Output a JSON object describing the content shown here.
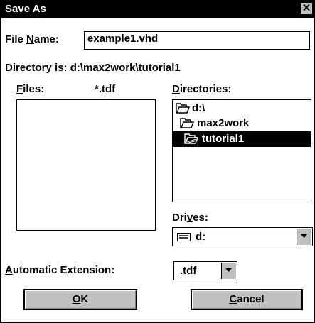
{
  "window": {
    "title": "Save As",
    "close_glyph": "✕"
  },
  "file_name": {
    "label_prefix": "File ",
    "label_key": "N",
    "label_suffix": "ame:",
    "value": "example1.vhd"
  },
  "directory": {
    "label": "Directory is:",
    "path": "d:\\max2work\\tutorial1"
  },
  "files": {
    "label_key": "F",
    "label_suffix": "iles:",
    "filter": "*.tdf",
    "items": []
  },
  "directories": {
    "label_key": "D",
    "label_suffix": "irectories:",
    "items": [
      {
        "label": "d:\\",
        "icon": "open-folder-icon",
        "selected": false
      },
      {
        "label": "max2work",
        "icon": "open-folder-icon",
        "selected": false
      },
      {
        "label": "tutorial1",
        "icon": "open-folder-icon",
        "selected": true
      }
    ]
  },
  "drives": {
    "label_prefix": "Dri",
    "label_key": "v",
    "label_suffix": "es:",
    "value": "d:",
    "icon": "drive-icon"
  },
  "extension": {
    "label_key": "A",
    "label_suffix": "utomatic Extension:",
    "value": ".tdf"
  },
  "buttons": {
    "ok": {
      "key": "O",
      "rest": "K"
    },
    "cancel": {
      "key": "C",
      "rest": "ancel"
    }
  },
  "colors": {
    "title_bar": "#000000",
    "selection": "#000000",
    "button_face": "#c0c0c0"
  }
}
